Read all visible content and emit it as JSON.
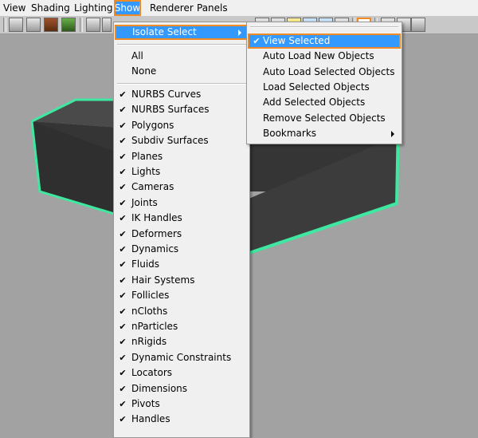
{
  "menubar": {
    "items": [
      "View",
      "Shading",
      "Lighting",
      "Show",
      "Renderer",
      "Panels"
    ],
    "active": "Show"
  },
  "toolbar": {
    "icons": [
      "select-camera-icon",
      "camera-attributes-icon",
      "bookmark-icon",
      "image-plane-icon",
      "grid-icon",
      "film-gate-icon",
      "resolution-gate-icon",
      "gate-mask-icon",
      "field-chart-icon",
      "safe-action-icon",
      "safe-title-icon",
      "wireframe-icon",
      "smooth-shade-icon",
      "isolate-select-icon",
      "high-quality-icon",
      "xray-icon",
      "camera-lock-icon"
    ]
  },
  "show_menu": {
    "isolate_select": "Isolate Select",
    "all": "All",
    "none": "None",
    "items": [
      {
        "label": "NURBS Curves",
        "checked": true
      },
      {
        "label": "NURBS Surfaces",
        "checked": true
      },
      {
        "label": "Polygons",
        "checked": true
      },
      {
        "label": "Subdiv Surfaces",
        "checked": true
      },
      {
        "label": "Planes",
        "checked": true
      },
      {
        "label": "Lights",
        "checked": true
      },
      {
        "label": "Cameras",
        "checked": true
      },
      {
        "label": "Joints",
        "checked": true
      },
      {
        "label": "IK Handles",
        "checked": true
      },
      {
        "label": "Deformers",
        "checked": true
      },
      {
        "label": "Dynamics",
        "checked": true
      },
      {
        "label": "Fluids",
        "checked": true
      },
      {
        "label": "Hair Systems",
        "checked": true
      },
      {
        "label": "Follicles",
        "checked": true
      },
      {
        "label": "nCloths",
        "checked": true
      },
      {
        "label": "nParticles",
        "checked": true
      },
      {
        "label": "nRigids",
        "checked": true
      },
      {
        "label": "Dynamic Constraints",
        "checked": true
      },
      {
        "label": "Locators",
        "checked": true
      },
      {
        "label": "Dimensions",
        "checked": true
      },
      {
        "label": "Pivots",
        "checked": true
      },
      {
        "label": "Handles",
        "checked": true
      }
    ]
  },
  "isolate_submenu": {
    "items": [
      {
        "label": "View Selected",
        "checked": true,
        "has_submenu": false
      },
      {
        "label": "Auto Load New Objects",
        "checked": false,
        "has_submenu": false
      },
      {
        "label": "Auto Load Selected Objects",
        "checked": false,
        "has_submenu": false
      },
      {
        "label": "Load Selected Objects",
        "checked": false,
        "has_submenu": false
      },
      {
        "label": "Add Selected Objects",
        "checked": false,
        "has_submenu": false
      },
      {
        "label": "Remove Selected Objects",
        "checked": false,
        "has_submenu": false
      },
      {
        "label": "Bookmarks",
        "checked": false,
        "has_submenu": true
      }
    ]
  },
  "colors": {
    "highlight": "#3399ff",
    "callout": "#f08a24",
    "selection_edge": "#3ee8a0",
    "viewport_bg": "#a2a2a2"
  }
}
